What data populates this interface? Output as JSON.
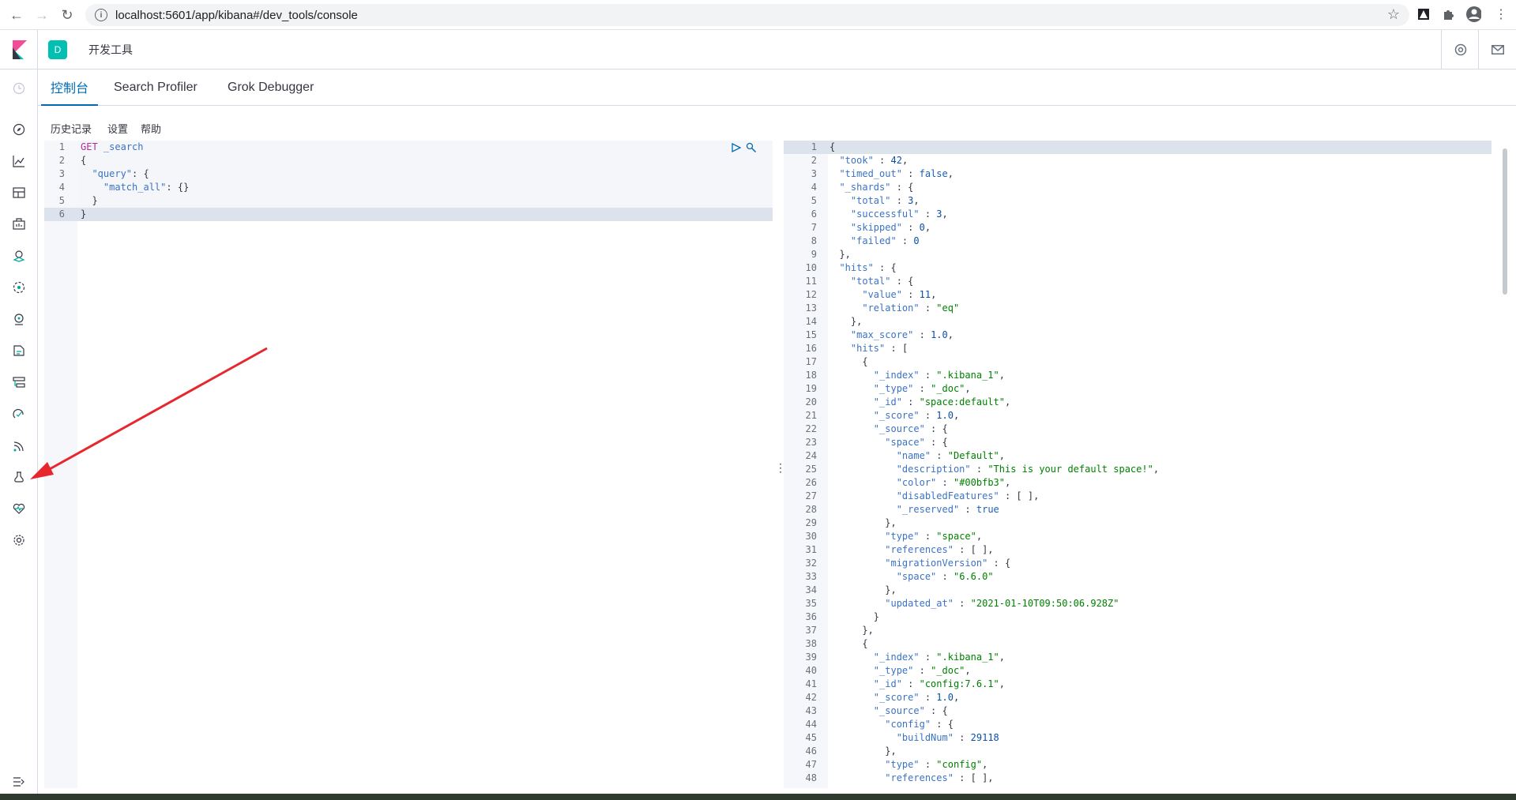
{
  "browser": {
    "url": "localhost:5601/app/kibana#/dev_tools/console"
  },
  "header": {
    "space_initial": "D",
    "breadcrumb": "开发工具"
  },
  "tabs": [
    {
      "label": "控制台",
      "active": true
    },
    {
      "label": "Search Profiler",
      "active": false
    },
    {
      "label": "Grok Debugger",
      "active": false
    }
  ],
  "toolbar": {
    "history": "历史记录",
    "settings": "设置",
    "help": "帮助"
  },
  "request_lines": [
    "1",
    "2",
    "3",
    "4",
    "5",
    "6"
  ],
  "response_lines": [
    "1",
    "2",
    "3",
    "4",
    "5",
    "6",
    "7",
    "8",
    "9",
    "10",
    "11",
    "12",
    "13",
    "14",
    "15",
    "16",
    "17",
    "18",
    "19",
    "20",
    "21",
    "22",
    "23",
    "24",
    "25",
    "26",
    "27",
    "28",
    "29",
    "30",
    "31",
    "32",
    "33",
    "34",
    "35",
    "36",
    "37",
    "38",
    "39",
    "40",
    "41",
    "42",
    "43",
    "44",
    "45",
    "46",
    "47",
    "48"
  ],
  "colors": {
    "accent": "#006bb4",
    "space": "#00bfb3",
    "arrow": "#e8262d"
  }
}
